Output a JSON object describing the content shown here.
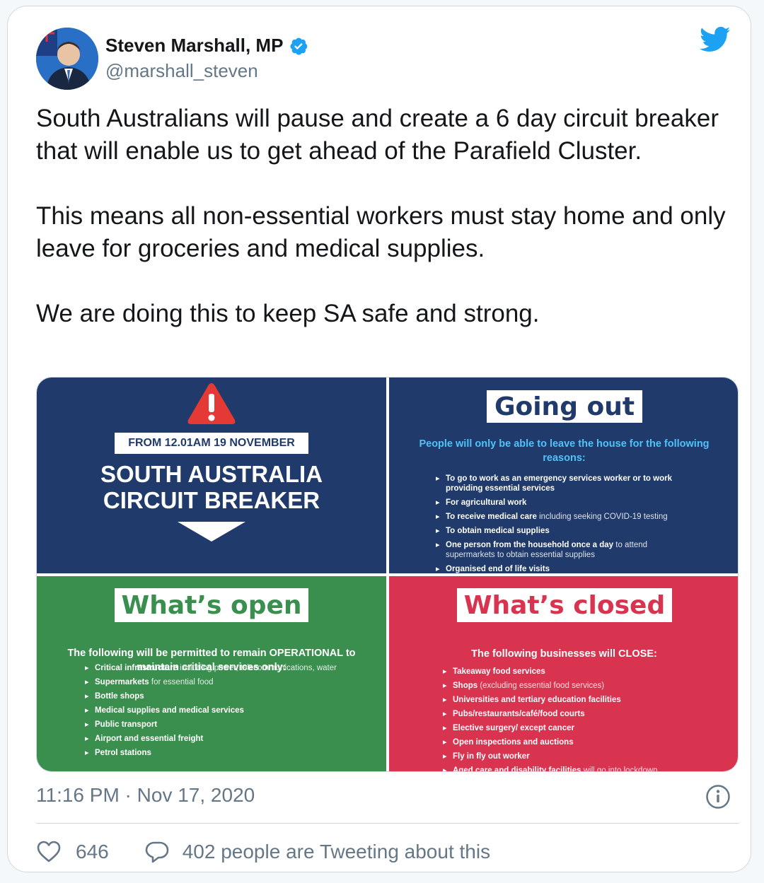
{
  "author": {
    "name": "Steven Marshall, MP",
    "handle": "@marshall_steven"
  },
  "tweet": {
    "text": "South Australians will pause and create a 6 day circuit breaker that will enable us to get ahead of the Parafield Cluster.\n\nThis means all non-essential workers must stay home and only leave for groceries and medical supplies.\n\nWe are doing this to keep SA safe and strong."
  },
  "media": {
    "top_left": {
      "date": "FROM 12.01AM 19 NOVEMBER",
      "title_line1": "SOUTH AUSTRALIA",
      "title_line2": "CIRCUIT BREAKER"
    },
    "going_out": {
      "heading": "Going out",
      "subtitle": "People will only be able to leave the house for the following reasons:",
      "items": [
        {
          "bold": "To go to work as an emergency services worker or to work providing essential services",
          "light": ""
        },
        {
          "bold": "For agricultural work",
          "light": ""
        },
        {
          "bold": "To receive medical care",
          "light": " including seeking COVID-19 testing"
        },
        {
          "bold": "To obtain medical supplies",
          "light": ""
        },
        {
          "bold": "One person from the household once a day",
          "light": " to attend supermarkets to obtain essential supplies"
        },
        {
          "bold": "Organised end of life visits",
          "light": ""
        }
      ]
    },
    "whats_open": {
      "heading": "What’s open",
      "subtitle": "The following will be permitted to remain OPERATIONAL to maintain critical services only:",
      "items": [
        {
          "bold": "Critical infrastructure",
          "light": " including power, telecommunications, water"
        },
        {
          "bold": "Supermarkets",
          "light": " for essential food"
        },
        {
          "bold": "Bottle shops",
          "light": ""
        },
        {
          "bold": "Medical supplies and medical services",
          "light": ""
        },
        {
          "bold": "Public transport",
          "light": ""
        },
        {
          "bold": "Airport and essential freight",
          "light": ""
        },
        {
          "bold": "Petrol stations",
          "light": ""
        }
      ]
    },
    "whats_closed": {
      "heading": "What’s closed",
      "subtitle": "The following businesses will CLOSE:",
      "items": [
        {
          "bold": "Takeaway food services",
          "light": ""
        },
        {
          "bold": "Shops",
          "light": " (excluding essential food services)"
        },
        {
          "bold": "Universities and tertiary education facilities",
          "light": ""
        },
        {
          "bold": "Pubs/restaurants/café/food courts",
          "light": ""
        },
        {
          "bold": "Elective surgery/ except cancer",
          "light": ""
        },
        {
          "bold": "Open inspections and auctions",
          "light": ""
        },
        {
          "bold": "Fly in fly out worker",
          "light": ""
        },
        {
          "bold": "Aged care and disability facilities",
          "light": " will go into lockdown"
        }
      ]
    }
  },
  "meta": {
    "timestamp": "11:16 PM · Nov 17, 2020"
  },
  "actions": {
    "likes": "646",
    "tweeting_about": "402 people are Tweeting about this"
  },
  "icons": {
    "verified": "verified-badge-icon",
    "bird": "twitter-bird-icon",
    "info": "info-icon",
    "like": "heart-icon",
    "reply": "speech-bubble-icon"
  },
  "colors": {
    "twitter_blue": "#1da1f2",
    "navy": "#1f3a6b",
    "green": "#3a8f4f",
    "red": "#d8344f"
  }
}
